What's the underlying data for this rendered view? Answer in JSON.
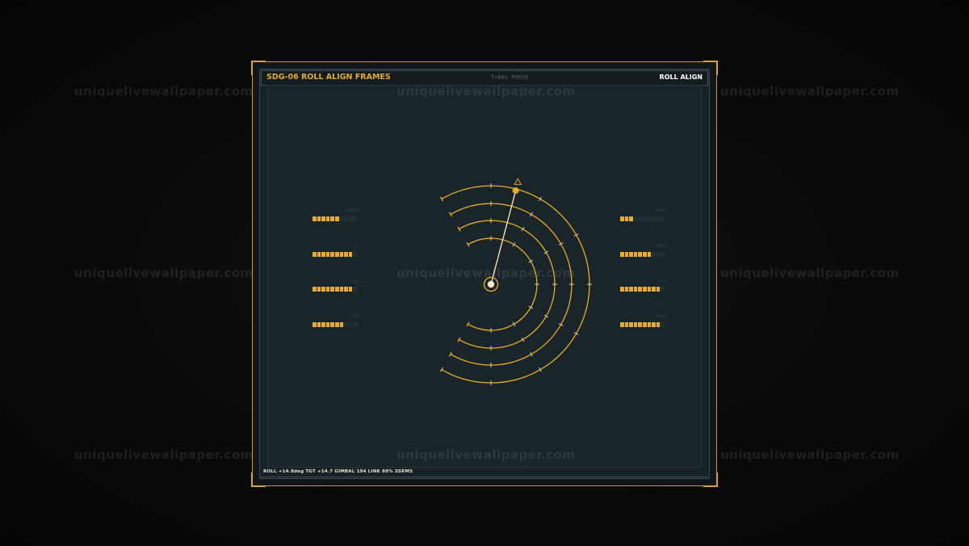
{
  "header": {
    "title": "SDG-06  ROLL ALIGN FRAMES",
    "meta": "T+00s  PH559",
    "mode": "ROLL ALIGN"
  },
  "footer": {
    "status": "ROLL +14.8deg  TGT +14.7  GIMBAL 194  LINK 88%  SSRMS"
  },
  "watermark": "uniquelivewallpaper.com",
  "dial": {
    "pointer_angle_deg": 14.8
  },
  "meters_left": [
    {
      "label": "MANRVR",
      "filled": 6,
      "total": 10
    },
    {
      "label": "LHL",
      "filled": 9,
      "total": 10
    },
    {
      "label": "UBAR",
      "filled": 9,
      "total": 10
    },
    {
      "label": "CRSR",
      "filled": 7,
      "total": 10
    }
  ],
  "meters_right": [
    {
      "label": "GRAPL",
      "filled": 3,
      "total": 10
    },
    {
      "label": "TORQUE",
      "filled": 7,
      "total": 10
    },
    {
      "label": "RATE",
      "filled": 9,
      "total": 10
    },
    {
      "label": "BRKNG",
      "filled": 9,
      "total": 10
    }
  ],
  "colors": {
    "accent": "#e8ac2a",
    "frame": "#c99b2c",
    "panel_bg": "#1a252a"
  }
}
